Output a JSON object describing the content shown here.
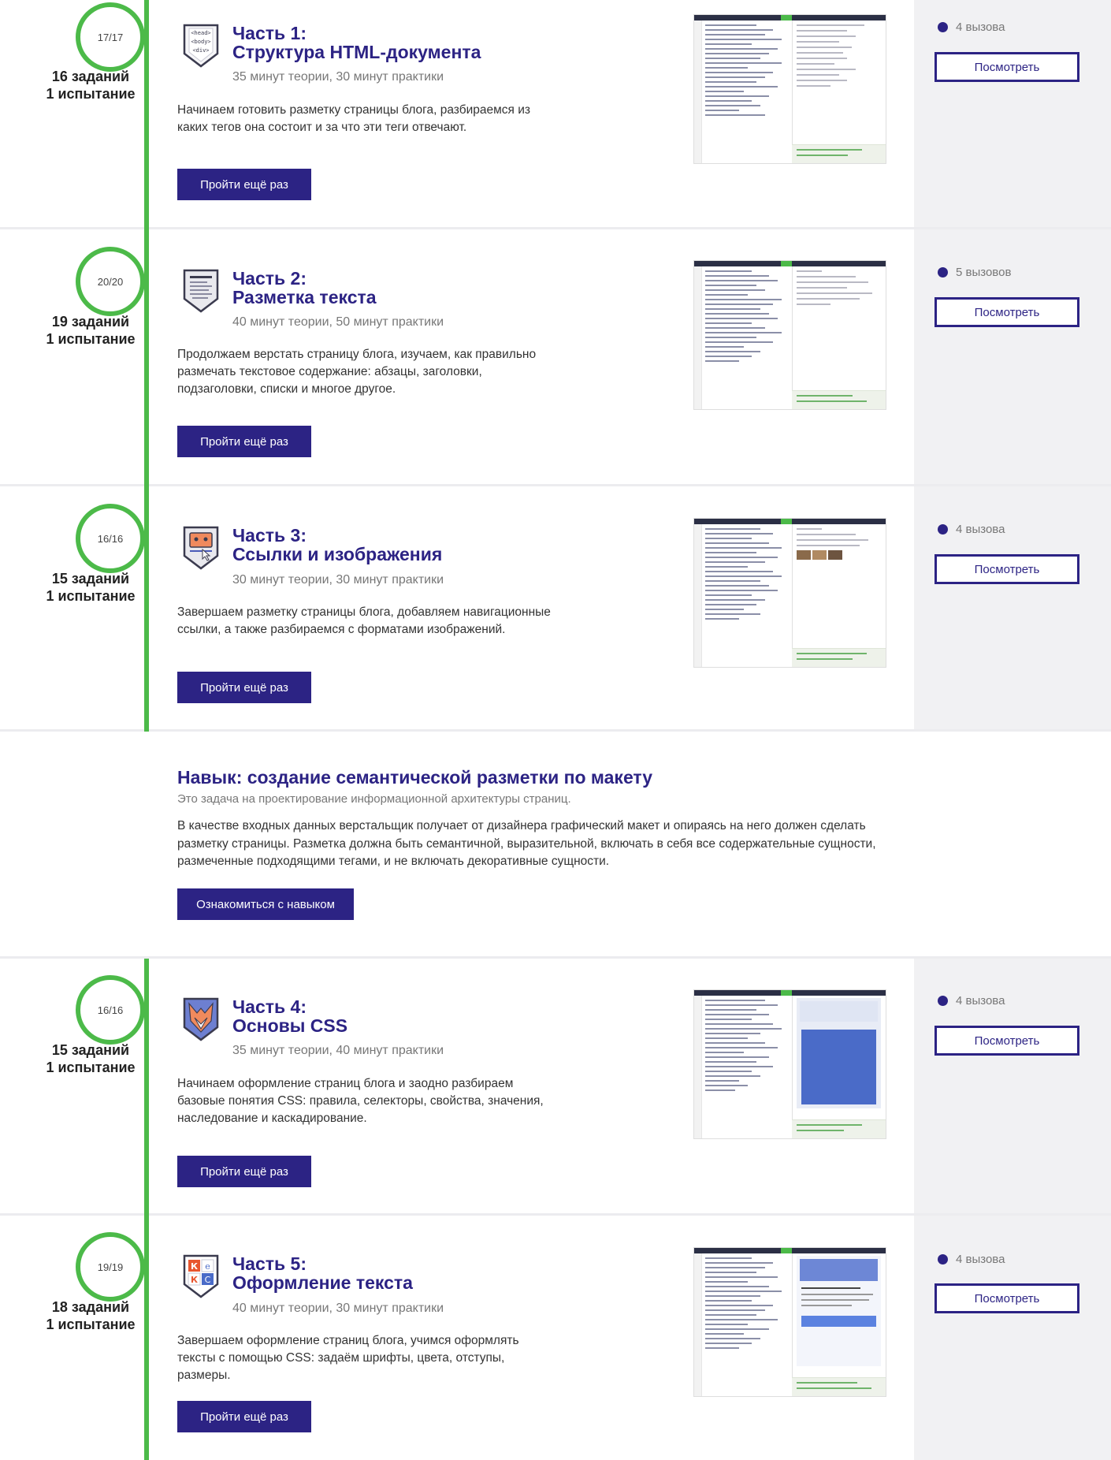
{
  "colors": {
    "accent": "#2c2384",
    "progress_green": "#4cba49",
    "side_panel": "#f1f1f3",
    "muted_text": "#777777"
  },
  "sections": [
    {
      "progress": "17/17",
      "tasks": "16 заданий",
      "trial": "1 испытание",
      "badge_icon": "html-tags-shield-icon",
      "badge_text": [
        "<head>",
        "<body>",
        "<div>"
      ],
      "title_line1": "Часть 1:",
      "title_line2": "Структура HTML-документа",
      "meta": "35 минут теории, 30 минут практики",
      "description": "Начинаем готовить разметку страницы блога, разбираемся из каких тегов она состоит и за что эти теги отвечают.",
      "button": "Пройти ещё раз",
      "screenshot_icon": "trainer-screenshot",
      "challenges": "4 вызова",
      "view_button": "Посмотреть"
    },
    {
      "progress": "20/20",
      "tasks": "19 заданий",
      "trial": "1 испытание",
      "badge_icon": "text-lines-shield-icon",
      "title_line1": "Часть 2:",
      "title_line2": "Разметка текста",
      "meta": "40 минут теории, 50 минут практики",
      "description": "Продолжаем верстать страницу блога, изучаем, как правильно размечать текстовое содержание: абзацы, заголовки, подзаголовки, списки и многое другое.",
      "button": "Пройти ещё раз",
      "screenshot_icon": "trainer-screenshot",
      "challenges": "5 вызовов",
      "view_button": "Посмотреть"
    },
    {
      "progress": "16/16",
      "tasks": "15 заданий",
      "trial": "1 испытание",
      "badge_icon": "link-image-shield-icon",
      "title_line1": "Часть 3:",
      "title_line2": "Ссылки и изображения",
      "meta": "30 минут теории, 30 минут практики",
      "description": "Завершаем разметку страницы блога, добавляем навигационные ссылки, а также разбираемся с форматами изображений.",
      "button": "Пройти ещё раз",
      "screenshot_icon": "trainer-screenshot",
      "challenges": "4 вызова",
      "view_button": "Посмотреть"
    },
    {
      "progress": "16/16",
      "tasks": "15 заданий",
      "trial": "1 испытание",
      "badge_icon": "css-fox-shield-icon",
      "title_line1": "Часть 4:",
      "title_line2": "Основы CSS",
      "meta": "35 минут теории, 40 минут практики",
      "description": "Начинаем оформление страниц блога и заодно разбираем базовые понятия CSS: правила, селекторы, свойства, значения, наследование и каскадирование.",
      "button": "Пройти ещё раз",
      "screenshot_icon": "trainer-screenshot",
      "challenges": "4 вызова",
      "view_button": "Посмотреть"
    },
    {
      "progress": "19/19",
      "tasks": "18 заданий",
      "trial": "1 испытание",
      "badge_icon": "text-style-shield-icon",
      "badge_letters": [
        "К",
        "е",
        "К",
        "С"
      ],
      "title_line1": "Часть 5:",
      "title_line2": "Оформление текста",
      "meta": "40 минут теории, 30 минут практики",
      "description": "Завершаем оформление страниц блога, учимся оформлять тексты с помощью CSS: задаём шрифты, цвета, отступы, размеры.",
      "button": "Пройти ещё раз",
      "screenshot_icon": "trainer-screenshot",
      "challenges": "4 вызова",
      "view_button": "Посмотреть"
    }
  ],
  "skill": {
    "title": "Навык: создание семантической разметки по макету",
    "subtitle": "Это задача на проектирование информационной архитектуры страниц.",
    "description": "В качестве входных данных верстальщик получает от дизайнера графический макет и опираясь на него должен сделать разметку страницы. Разметка должна быть семантичной, выразительной, включать в себя все содержательные сущности, размеченные подходящими тегами, и не включать декоративные сущности.",
    "button": "Ознакомиться с навыком"
  }
}
